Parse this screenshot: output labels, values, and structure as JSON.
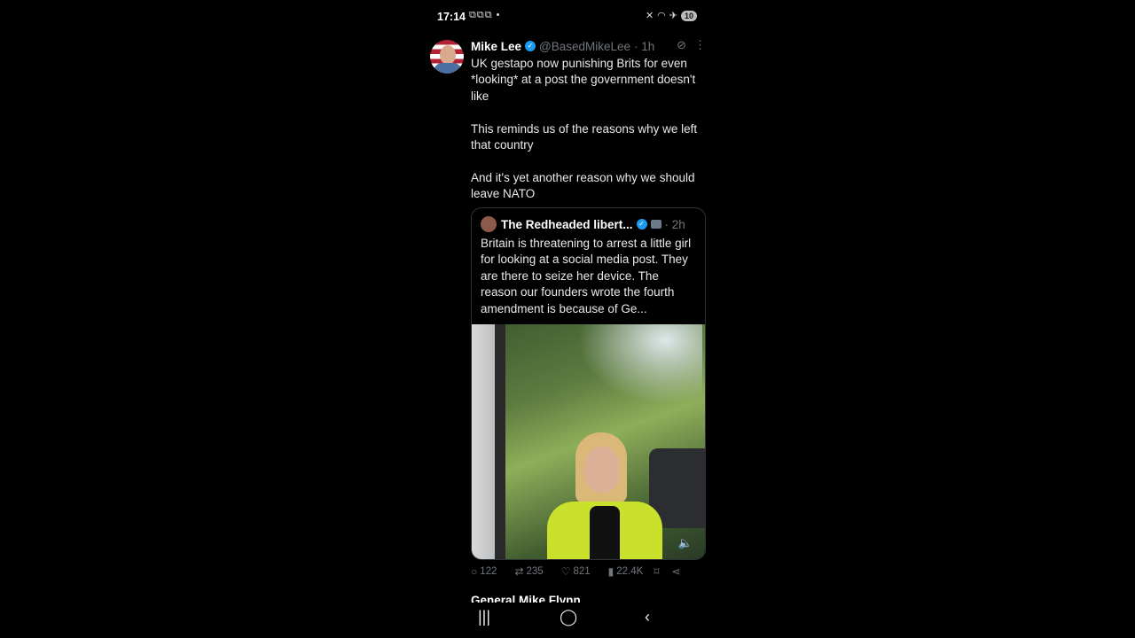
{
  "status_bar": {
    "time": "17:14",
    "battery": "10"
  },
  "tweet": {
    "author_name": "Mike Lee",
    "handle": "@BasedMikeLee",
    "time": "· 1h",
    "body": [
      "UK gestapo now punishing Brits for even *looking* at a post the government doesn't like",
      "This reminds us of the reasons why we left that country",
      "And it's yet another reason why we should leave NATO"
    ],
    "quote": {
      "author_name": "The Redheaded libert...",
      "time": "· 2h",
      "text": "Britain is threatening to arrest a little girl for looking at a social media post. They are there to seize her device. The reason our founders wrote the fourth amendment is because of Ge..."
    },
    "actions": {
      "replies": "122",
      "reposts": "235",
      "likes": "821",
      "views": "22.4K"
    }
  },
  "next_tweet": {
    "author_name": "General Mike Flynn"
  },
  "colors": {
    "background": "#000000",
    "text": "#e7e9ea",
    "muted": "#71767b",
    "verified": "#1d9bf0"
  }
}
